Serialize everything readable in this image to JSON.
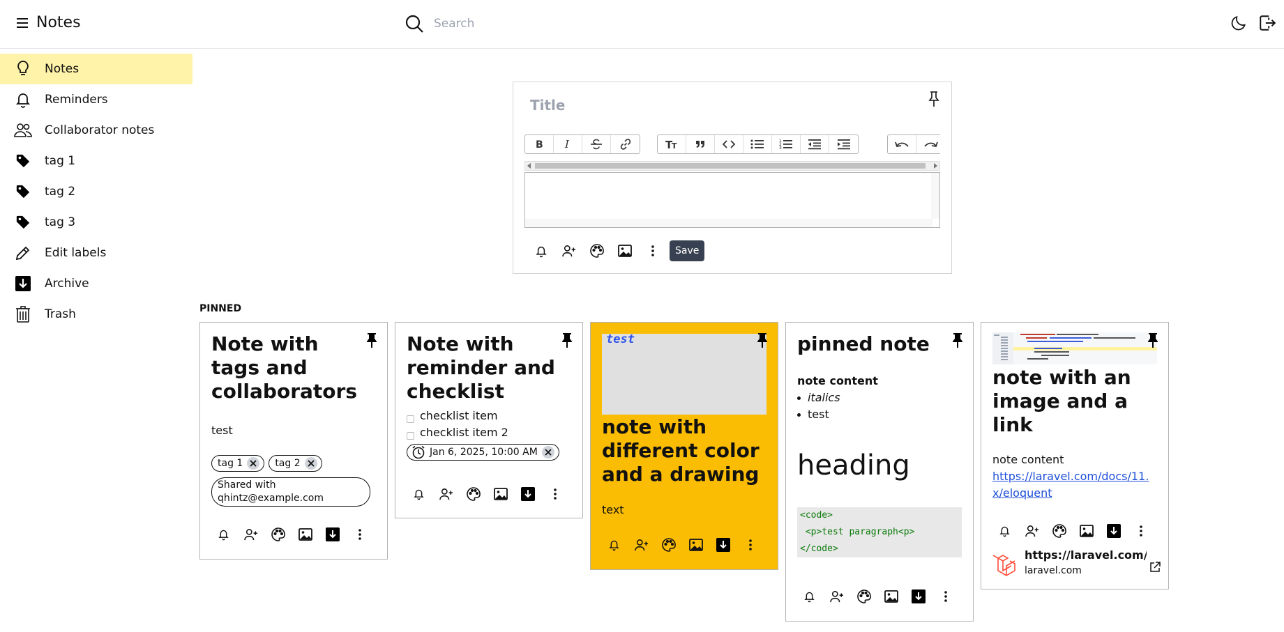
{
  "header": {
    "app_title": "Notes",
    "search_placeholder": "Search"
  },
  "sidebar": {
    "items": [
      {
        "label": "Notes",
        "icon": "lightbulb-icon",
        "active": true
      },
      {
        "label": "Reminders",
        "icon": "bell-icon"
      },
      {
        "label": "Collaborator notes",
        "icon": "users-icon"
      },
      {
        "label": "tag 1",
        "icon": "tag-icon"
      },
      {
        "label": "tag 2",
        "icon": "tag-icon"
      },
      {
        "label": "tag 3",
        "icon": "tag-icon"
      },
      {
        "label": "Edit labels",
        "icon": "pencil-icon"
      },
      {
        "label": "Archive",
        "icon": "archive-icon"
      },
      {
        "label": "Trash",
        "icon": "trash-icon"
      }
    ]
  },
  "editor": {
    "title_placeholder": "Title",
    "save_label": "Save"
  },
  "section": {
    "pinned_label": "PINNED"
  },
  "notes": [
    {
      "title": "Note with tags and collaborators",
      "body": "test",
      "tags": [
        "tag 1",
        "tag 2"
      ],
      "shared_with": "Shared with qhintz@example.com"
    },
    {
      "title": "Note with reminder and checklist",
      "checklist": [
        "checklist item",
        "checklist item 2"
      ],
      "reminder": "Jan 6, 2025, 10:00 AM"
    },
    {
      "title": "note with different color and a drawing",
      "body": "text",
      "drawing_text": "test",
      "color": "#fbbc04"
    },
    {
      "title": "pinned note",
      "content_heading": "note content",
      "bullets": [
        "italics",
        "test"
      ],
      "heading": "heading",
      "code_lines": [
        "<code>",
        " <p>test paragraph<p>",
        "</code>"
      ]
    },
    {
      "title": "note with an image and a link",
      "body": "note content",
      "link": "https://laravel.com/docs/11.x/eloquent",
      "preview_title": "https://laravel.com/do",
      "preview_domain": "laravel.com"
    }
  ]
}
